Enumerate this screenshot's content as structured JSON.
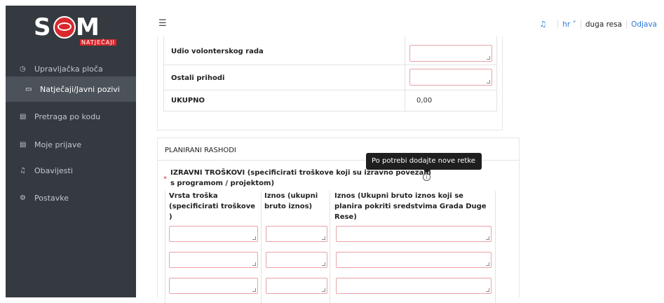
{
  "brand": {
    "name_left": "S",
    "name_right": "M",
    "subtitle": "NATJEČAJI"
  },
  "sidebar": {
    "items": [
      {
        "icon": "dashboard-icon",
        "glyph": "◷",
        "label": "Upravljačka ploča"
      },
      {
        "icon": "folder-icon",
        "glyph": "▭",
        "label": "Natječaji/Javni pozivi",
        "active": true
      },
      {
        "icon": "document-search-icon",
        "glyph": "▤",
        "label": "Pretraga po kodu"
      },
      {
        "icon": "document-icon",
        "glyph": "▤",
        "label": "Moje prijave"
      },
      {
        "icon": "bell-icon",
        "glyph": "♫",
        "label": "Obavijesti"
      },
      {
        "icon": "settings-icon",
        "glyph": "⚙",
        "label": "Postavke"
      }
    ]
  },
  "topbar": {
    "menu_glyph": "☰",
    "bell_glyph": "♫",
    "lang": "hr ˅",
    "user": "duga resa",
    "logout": "Odjava"
  },
  "income_table": {
    "rows": [
      {
        "label": "Udio volonterskog rada",
        "value": "",
        "editable": true
      },
      {
        "label": "Ostali prihodi",
        "value": "",
        "editable": true
      },
      {
        "label": "UKUPNO",
        "value": "0,00",
        "editable": false
      }
    ]
  },
  "expenses": {
    "section_title": "PLANIRANI RASHODI",
    "required_mark": "*",
    "direct_costs_title": "IZRAVNI TROŠKOVI (specificirati troškove koji su izravno povezani s programom / projektom)",
    "info_glyph": "i",
    "tooltip": "Po potrebi dodajte nove retke",
    "columns": [
      "Vrsta troška (specificirati troškove )",
      "Iznos (ukupni bruto iznos)",
      "Iznos (Ukupni bruto iznos koji se planira pokriti sredstvima Grada Duge Rese)"
    ],
    "rows": [
      [
        "",
        "",
        ""
      ],
      [
        "",
        "",
        ""
      ],
      [
        "",
        "",
        ""
      ]
    ]
  }
}
